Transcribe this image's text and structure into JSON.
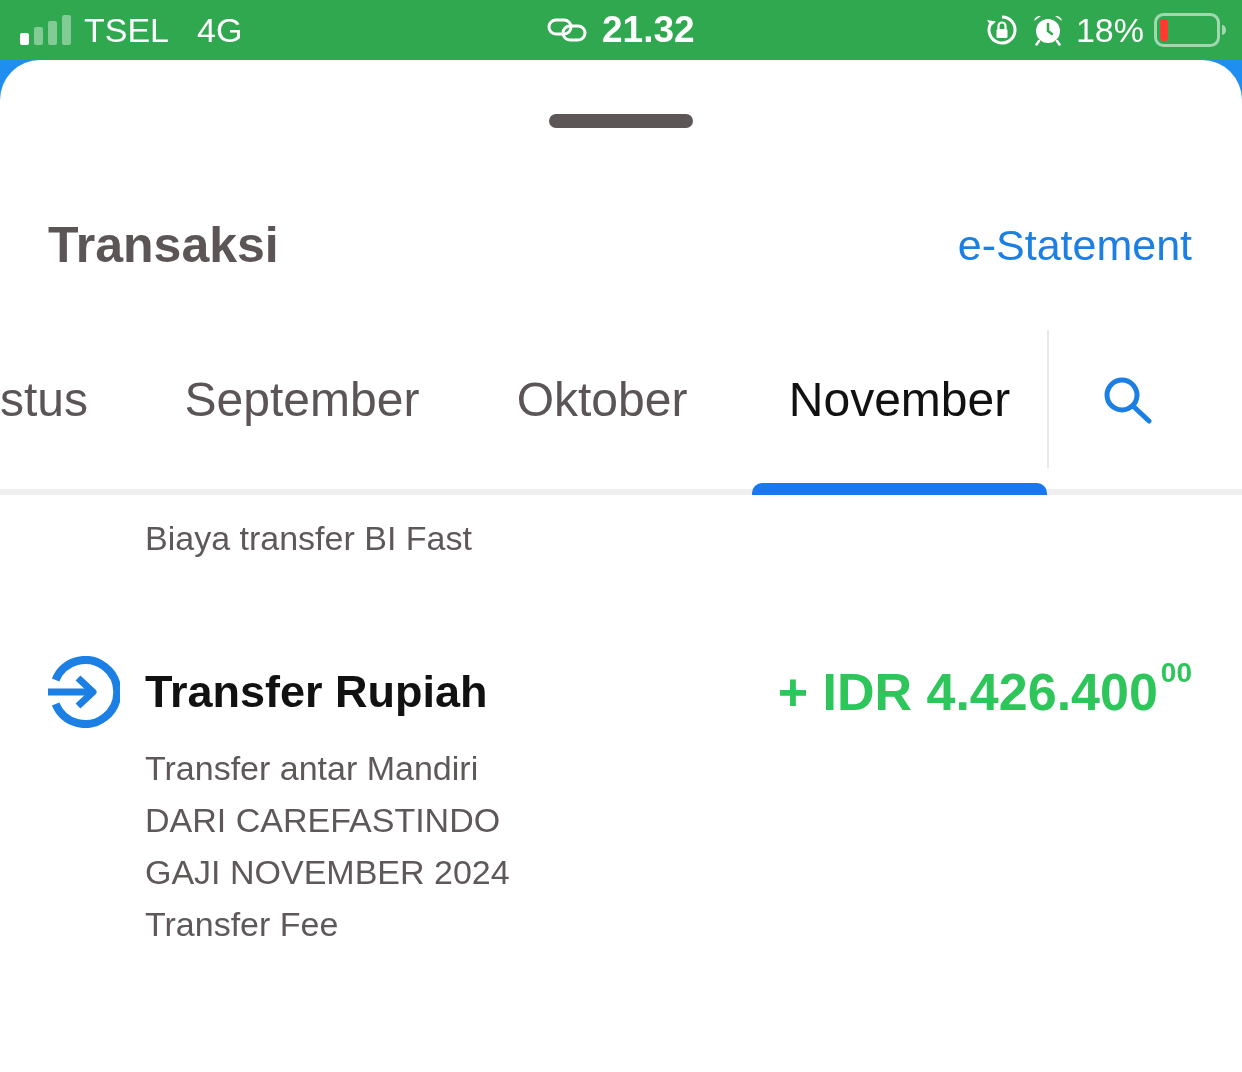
{
  "status_bar": {
    "carrier": "TSEL",
    "network": "4G",
    "time": "21.32",
    "battery": "18%"
  },
  "header": {
    "title": "Transaksi",
    "link": "e-Statement"
  },
  "tabs": [
    {
      "label": "stus",
      "selected": false
    },
    {
      "label": "September",
      "selected": false
    },
    {
      "label": "Oktober",
      "selected": false
    },
    {
      "label": "November",
      "selected": true
    }
  ],
  "transactions": [
    {
      "details": [
        "Biaya transfer BI Fast"
      ]
    },
    {
      "kind": "incoming",
      "title": "Transfer Rupiah",
      "amount": "+ IDR 4.426.400$^{00}$",
      "details": [
        "Transfer antar Mandiri",
        "DARI CAREFASTINDO",
        "GAJI NOVEMBER 2024",
        "Transfer Fee"
      ]
    }
  ]
}
